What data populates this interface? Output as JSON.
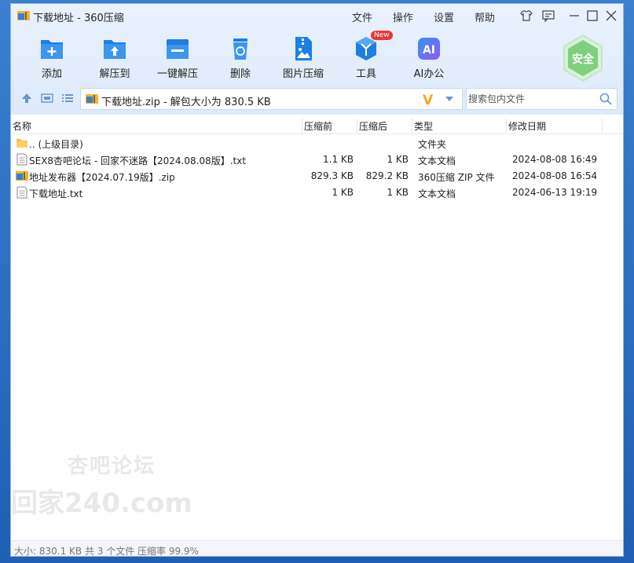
{
  "window": {
    "title": "下载地址 - 360压缩"
  },
  "menu": {
    "file": "文件",
    "action": "操作",
    "settings": "设置",
    "help": "帮助"
  },
  "toolbar": {
    "add": "添加",
    "extract_to": "解压到",
    "one_click_extract": "一键解压",
    "delete": "删除",
    "image_compress": "图片压缩",
    "tools": "工具",
    "tools_badge": "New",
    "ai_office": "AI办公",
    "safe": "安全"
  },
  "address": {
    "text": "下载地址.zip - 解包大小为 830.5 KB",
    "v_mark": "V"
  },
  "search": {
    "placeholder": "搜索包内文件"
  },
  "columns": {
    "name": "名称",
    "before": "压缩前",
    "after": "压缩后",
    "type": "类型",
    "modified": "修改日期"
  },
  "files": [
    {
      "name": ".. (上级目录)",
      "before": "",
      "after": "",
      "type": "文件夹",
      "modified": "",
      "icon": "folder-icon"
    },
    {
      "name": "SEX8杏吧论坛 - 回家不迷路【2024.08.08版】.txt",
      "before": "1.1 KB",
      "after": "1 KB",
      "type": "文本文档",
      "modified": "2024-08-08 16:49",
      "icon": "text-file-icon"
    },
    {
      "name": "地址发布器【2024.07.19版】.zip",
      "before": "829.3 KB",
      "after": "829.2 KB",
      "type": "360压缩 ZIP 文件",
      "modified": "2024-08-08 16:54",
      "icon": "zip-file-icon"
    },
    {
      "name": "下载地址.txt",
      "before": "1 KB",
      "after": "1 KB",
      "type": "文本文档",
      "modified": "2024-06-13 19:19",
      "icon": "text-file-icon"
    }
  ],
  "watermark": {
    "line1": "杏吧论坛",
    "line2": "回家240.com"
  },
  "status": {
    "text": "大小: 830.1 KB 共 3 个文件 压缩率 99.9%"
  },
  "colors": {
    "accent": "#1f7ee0",
    "safe_green": "#4caf50",
    "badge_red": "#e53935",
    "v_orange": "#f5a623"
  }
}
